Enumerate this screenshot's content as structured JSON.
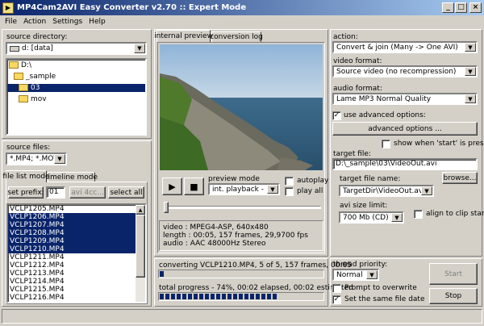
{
  "window": {
    "title": "MP4Cam2AVI Easy Converter v2.70 :: Expert Mode",
    "min": "_",
    "max": "□",
    "close": "×"
  },
  "menu": {
    "file": "File",
    "action": "Action",
    "settings": "Settings",
    "help": "Help"
  },
  "left": {
    "source_dir_label": "source directory:",
    "drive_value": "d: [data]",
    "tree": [
      "D:\\",
      "_sample",
      "03",
      "mov"
    ],
    "source_files_label": "source files:",
    "filter_value": "*.MP4; *.MOV",
    "tabs": {
      "file_list": "file list mode",
      "timeline": "timeline mode"
    },
    "set_prefix": "set prefix:",
    "prefix_value": "01",
    "avi4cc": "avi 4cc...",
    "select_all": "select all",
    "files": [
      {
        "name": "VCLP1205.MP4",
        "selected": false
      },
      {
        "name": "VCLP1206.MP4",
        "selected": true
      },
      {
        "name": "VCLP1207.MP4",
        "selected": true
      },
      {
        "name": "VCLP1208.MP4",
        "selected": true
      },
      {
        "name": "VCLP1209.MP4",
        "selected": true
      },
      {
        "name": "VCLP1210.MP4",
        "selected": true
      },
      {
        "name": "VCLP1211.MP4",
        "selected": false
      },
      {
        "name": "VCLP1212.MP4",
        "selected": false
      },
      {
        "name": "VCLP1213.MP4",
        "selected": false
      },
      {
        "name": "VCLP1214.MP4",
        "selected": false
      },
      {
        "name": "VCLP1215.MP4",
        "selected": false
      },
      {
        "name": "VCLP1216.MP4",
        "selected": false
      }
    ]
  },
  "center": {
    "tabs": {
      "preview": "internal preview",
      "log": "conversion log"
    },
    "preview_mode_label": "preview mode",
    "preview_mode_value": "int. playback - 1x",
    "autoplay": "autoplay",
    "play_all": "play all",
    "info": {
      "video": "video   : MPEG4-ASP, 640x480",
      "length": "length : 00:05, 157 frames, 29,9700 fps",
      "audio": "audio  : AAC 48000Hz Stereo"
    },
    "converting": "converting VCLP1210.MP4, 5 of 5, 157 frames, 00:05",
    "converting_progress": 0.02,
    "total": "total progress - 74%,  00:02 elapsed,  00:02 estimated",
    "total_progress": 0.74
  },
  "right": {
    "action_label": "action:",
    "action_value": "Convert & join (Many -> One AVI)",
    "video_format_label": "video format:",
    "video_format_value": "Source video (no recompression)",
    "audio_format_label": "audio format:",
    "audio_format_value": "Lame MP3 Normal Quality",
    "use_advanced": "use advanced options:",
    "advanced_button": "advanced options ...",
    "show_when_start": "show when 'start' is pressed",
    "target_file_label": "target file:",
    "target_file_value": "D:\\_sample\\03\\VideoOut.avi",
    "target_name_label": "target file name:",
    "target_name_value": "TargetDir\\VideoOut.avi",
    "browse": "browse...",
    "avi_size_label": "avi size limit:",
    "avi_size_value": "700 Mb (CD)",
    "align_to_clip": "align to clip start",
    "thread_priority_label": "thread priority:",
    "thread_priority_value": "Normal",
    "prompt_overwrite": "Prompt to overwrite",
    "same_file_date": "Set the same file date",
    "start": "Start",
    "stop": "Stop"
  },
  "colors": {
    "selection": "#0a246a",
    "titlebar": "#0a246a",
    "face": "#d4d0c8"
  }
}
